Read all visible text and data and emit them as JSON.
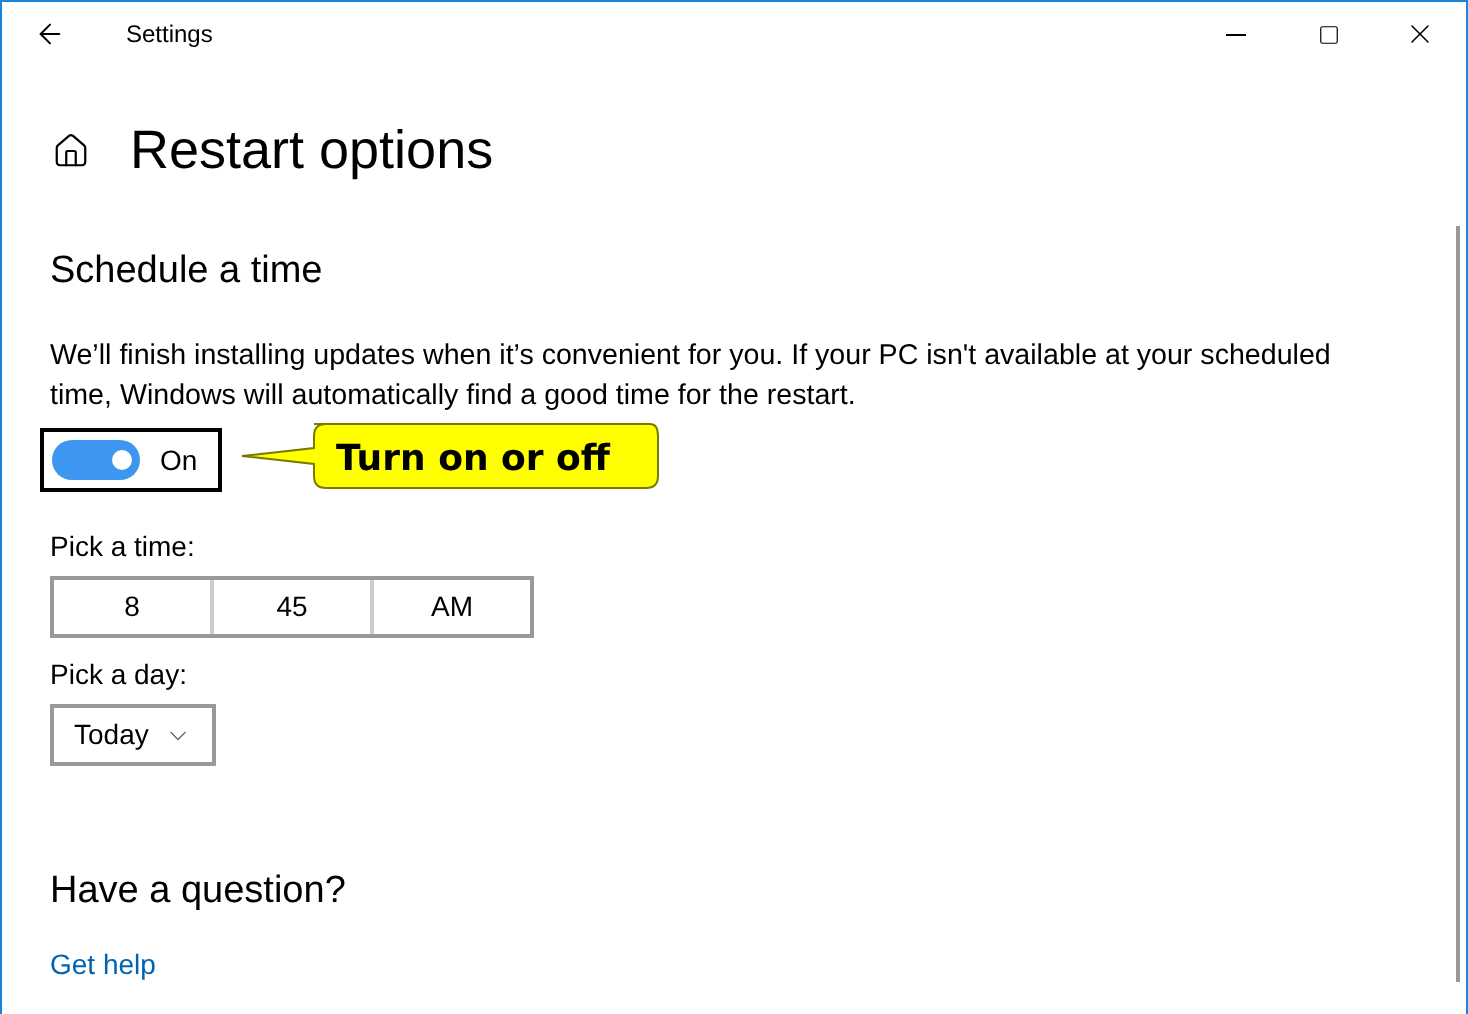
{
  "window": {
    "title": "Settings"
  },
  "page_title": "Restart options",
  "section": {
    "heading": "Schedule a time",
    "description": "We’ll finish installing updates when it’s convenient for you. If your PC isn't available at your scheduled time, Windows will automatically find a good time for the restart."
  },
  "toggle": {
    "on": true,
    "label": "On"
  },
  "callout": "Turn on or off",
  "time": {
    "label": "Pick a time:",
    "parts": [
      "8",
      "45",
      "AM"
    ]
  },
  "day": {
    "label": "Pick a day:",
    "value": "Today"
  },
  "help": {
    "heading": "Have a question?",
    "link": "Get help"
  }
}
